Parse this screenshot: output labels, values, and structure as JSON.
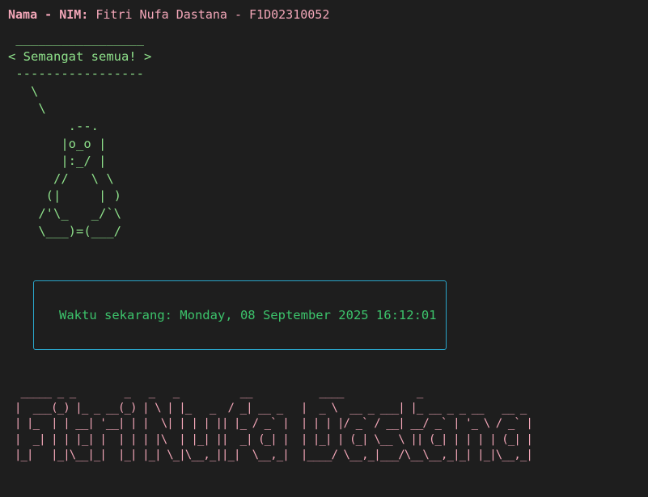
{
  "header": {
    "label": "Nama - NIM:",
    "value": " Fitri Nufa Dastana - F1D02310052"
  },
  "cowsay": {
    "art": " _________________\n< Semangat semua! >\n -----------------\n   \\\n    \\\n        .--.\n       |o_o |\n       |:_/ |\n      //   \\ \\\n     (|     | )\n    /'\\_   _/`\\\n    \\___)=(___/"
  },
  "clock": {
    "text": "Waktu sekarang: Monday, 08 September 2025 16:12:01"
  },
  "banner": {
    "art": " _____ _ _        _   _   _          __           ____            _                    \n|  ___(_) |_ _ __(_) | \\ | |_   _  / _| __ _   |  _ \\  __ _ ___| |_ __ _ _ __   __ _ \n| |_  | | __| '__| | |  \\| | | | || |_ / _` |  | | | |/ _` / __| __/ _` | '_ \\ / _` |\n|  _| | | |_| |  | | | |\\  | |_| ||  _| (_| |  | |_| | (_| \\__ \\ || (_| | | | | (_| |\n|_|   |_|\\__|_|  |_| |_| \\_|\\__,_||_|  \\__,_|  |____/ \\__,_|___/\\__\\__,_|_| |_|\\__,_|"
  }
}
